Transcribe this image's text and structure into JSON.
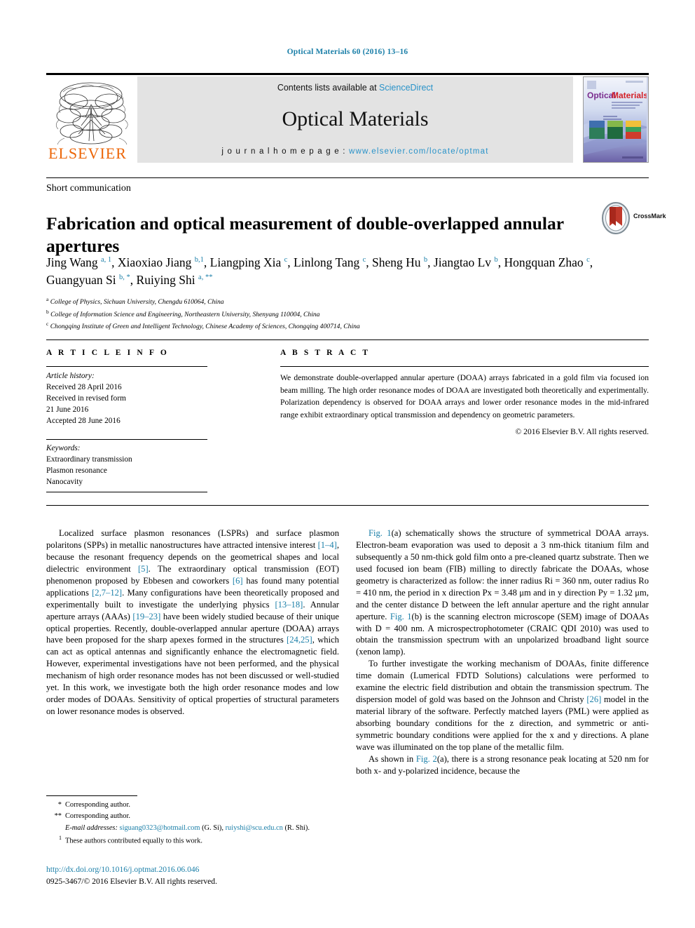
{
  "running_head": "Optical Materials 60 (2016) 13–16",
  "masthead": {
    "contents_prefix": "Contents lists available at ",
    "sciencedirect": "ScienceDirect",
    "journal_name": "Optical Materials",
    "homepage_prefix": "j o u r n a l   h o m e p a g e :  ",
    "homepage_url": "www.elsevier.com/locate/optmat",
    "publisher": "ELSEVIER",
    "cover_title_1": "Optical",
    "cover_title_2": "Materials",
    "logo_icon": "elsevier-tree-logo",
    "accent_color": "#2a93c9",
    "publisher_color": "#ec6608"
  },
  "article": {
    "doctype": "Short communication",
    "title": "Fabrication and optical measurement of double-overlapped annular apertures",
    "crossmark_label": "CrossMark",
    "authors_html": "Jing Wang <sup>a, 1</sup>, Xiaoxiao Jiang <sup>b,1</sup>, Liangping Xia <sup>c</sup>, Linlong Tang <sup>c</sup>, Sheng Hu <sup>b</sup>, Jiangtao Lv <sup>b</sup>, Hongquan Zhao <sup>c</sup>, Guangyuan Si <sup>b, *</sup>, Ruiying Shi <sup>a, **</sup>",
    "affiliations": [
      "a College of Physics, Sichuan University, Chengdu 610064, China",
      "b College of Information Science and Engineering, Northeastern University, Shenyang 110004, China",
      "c Chongqing Institute of Green and Intelligent Technology, Chinese Academy of Sciences, Chongqing 400714, China"
    ]
  },
  "info": {
    "heading": "A R T I C L E   I N F O",
    "history_label": "Article history:",
    "history": [
      "Received 28 April 2016",
      "Received in revised form",
      "21 June 2016",
      "Accepted 28 June 2016"
    ],
    "keywords_label": "Keywords:",
    "keywords": [
      "Extraordinary transmission",
      "Plasmon resonance",
      "Nanocavity"
    ]
  },
  "abstract": {
    "heading": "A B S T R A C T",
    "text": "We demonstrate double-overlapped annular aperture (DOAA) arrays fabricated in a gold film via focused ion beam milling. The high order resonance modes of DOAA are investigated both theoretically and experimentally. Polarization dependency is observed for DOAA arrays and lower order resonance modes in the mid-infrared range exhibit extraordinary optical transmission and dependency on geometric parameters.",
    "copyright": "© 2016 Elsevier B.V. All rights reserved."
  },
  "body": {
    "left_paragraph_1": "Localized surface plasmon resonances (LSPRs) and surface plasmon polaritons (SPPs) in metallic nanostructures have attracted intensive interest [1–4], because the resonant frequency depends on the geometrical shapes and local dielectric environment [5]. The extraordinary optical transmission (EOT) phenomenon proposed by Ebbesen and coworkers [6] has found many potential applications [2,7–12]. Many configurations have been theoretically proposed and experimentally built to investigate the underlying physics [13–18]. Annular aperture arrays (AAAs) [19–23] have been widely studied because of their unique optical properties. Recently, double-overlapped annular aperture (DOAA) arrays have been proposed for the sharp apexes formed in the structures [24,25], which can act as optical antennas and significantly enhance the electromagnetic field. However, experimental investigations have not been performed, and the physical mechanism of high order resonance modes has not been discussed or well-studied yet. In this work, we investigate both the high order resonance modes and low order modes of DOAAs. Sensitivity of optical properties of structural parameters on lower resonance modes is observed.",
    "right_paragraph_1": "Fig. 1(a) schematically shows the structure of symmetrical DOAA arrays. Electron-beam evaporation was used to deposit a 3 nm-thick titanium film and subsequently a 50 nm-thick gold film onto a pre-cleaned quartz substrate. Then we used focused ion beam (FIB) milling to directly fabricate the DOAAs, whose geometry is characterized as follow: the inner radius Ri = 360 nm, outer radius Ro = 410 nm, the period in x direction Px = 3.48 μm and in y direction Py = 1.32 μm, and the center distance D between the left annular aperture and the right annular aperture. Fig. 1(b) is the scanning electron microscope (SEM) image of DOAAs with D = 400 nm. A microspectrophotometer (CRAIC QDI 2010) was used to obtain the transmission spectrum with an unpolarized broadband light source (xenon lamp).",
    "right_paragraph_2": "To further investigate the working mechanism of DOAAs, finite difference time domain (Lumerical FDTD Solutions) calculations were performed to examine the electric field distribution and obtain the transmission spectrum. The dispersion model of gold was based on the Johnson and Christy [26] model in the material library of the software. Perfectly matched layers (PML) were applied as absorbing boundary conditions for the z direction, and symmetric or anti-symmetric boundary conditions were applied for the x and y directions. A plane wave was illuminated on the top plane of the metallic film.",
    "right_paragraph_3": "As shown in Fig. 2(a), there is a strong resonance peak locating at 520 nm for both x- and y-polarized incidence, because the"
  },
  "footnotes": {
    "corresponding_1_marker": "*",
    "corresponding_1": "Corresponding author.",
    "corresponding_2_marker": "**",
    "corresponding_2": "Corresponding author.",
    "email_label": "E-mail addresses:",
    "email_1": "siguang0323@hotmail.com",
    "email_1_owner": "(G. Si),",
    "email_2": "ruiyshi@scu.edu.cn",
    "email_2_owner": "(R. Shi).",
    "note_1_marker": "1",
    "note_1": "These authors contributed equally to this work.",
    "doi": "http://dx.doi.org/10.1016/j.optmat.2016.06.046",
    "issn_line": "0925-3467/© 2016 Elsevier B.V. All rights reserved."
  }
}
